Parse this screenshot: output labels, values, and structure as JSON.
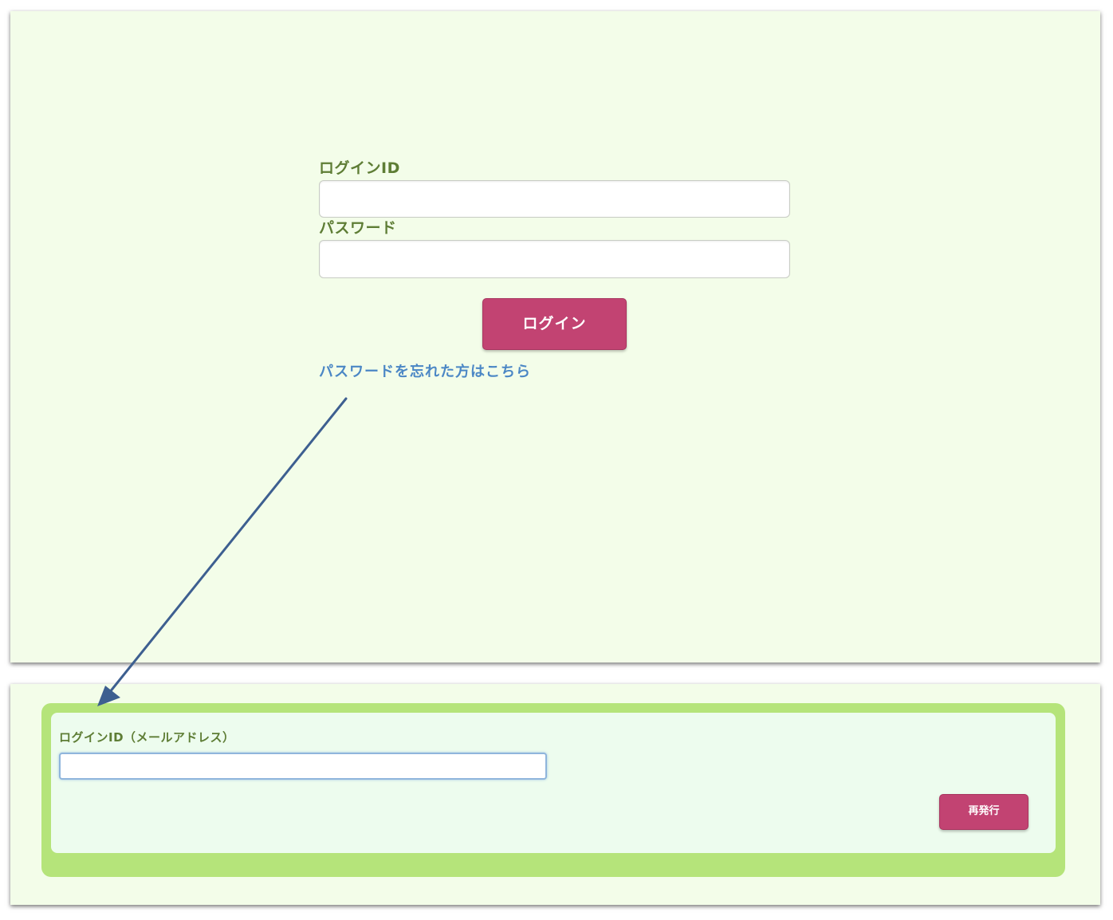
{
  "login_form": {
    "login_id_label": "ログインID",
    "login_id_value": "",
    "password_label": "パスワード",
    "password_value": "",
    "login_button_label": "ログイン",
    "forgot_password_link": "パスワードを忘れた方はこちら"
  },
  "password_reset_form": {
    "email_label": "ログインID（メールアドレス）",
    "email_value": "",
    "reissue_button_label": "再発行"
  },
  "colors": {
    "panel_background": "#f3fde9",
    "label_text": "#5e7d35",
    "primary_button": "#c24372",
    "link_text": "#4b87c5",
    "reset_frame_border": "#b5e47a",
    "annotation_arrow": "#3d5f90"
  },
  "icons": {
    "annotation": "arrow-icon"
  }
}
